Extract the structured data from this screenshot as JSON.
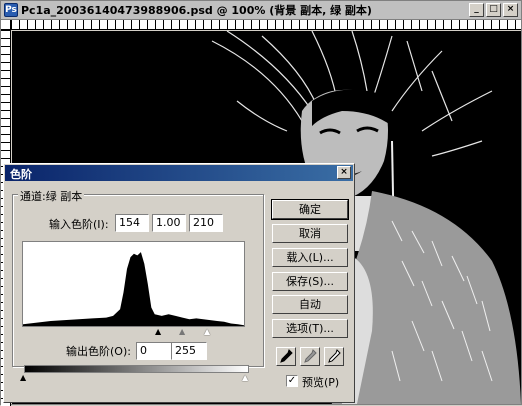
{
  "document": {
    "title": "Pc1a_20036140473988906.psd @ 100% (背景 副本, 绿 副本)",
    "icon": "photoshop-doc-icon",
    "window_buttons": [
      "_",
      "□",
      "×"
    ]
  },
  "dialog": {
    "title": "色阶",
    "close": "×",
    "channel_label": "通道:绿 副本",
    "input_levels_label": "输入色阶(I):",
    "input_black": "154",
    "input_gamma": "1.00",
    "input_white": "210",
    "output_levels_label": "输出色阶(O):",
    "output_black": "0",
    "output_white": "255",
    "buttons": {
      "ok": "确定",
      "cancel": "取消",
      "load": "载入(L)...",
      "save": "保存(S)...",
      "auto": "自动",
      "options": "选项(T)..."
    },
    "preview_label": "预览(P)",
    "preview_checked": "✓"
  },
  "chart_data": {
    "type": "area",
    "x": [
      0,
      16,
      32,
      48,
      64,
      80,
      96,
      104,
      112,
      116,
      120,
      124,
      128,
      132,
      136,
      140,
      144,
      148,
      152,
      160,
      168,
      176,
      184,
      192,
      200,
      208,
      216,
      224,
      232,
      240,
      248,
      255
    ],
    "y": [
      2,
      4,
      6,
      7,
      8,
      9,
      10,
      12,
      20,
      40,
      68,
      82,
      86,
      84,
      88,
      74,
      50,
      22,
      14,
      12,
      14,
      12,
      10,
      8,
      9,
      8,
      7,
      6,
      5,
      3,
      2,
      1
    ],
    "xlim": [
      0,
      255
    ],
    "ylim": [
      0,
      100
    ],
    "grid": false
  }
}
